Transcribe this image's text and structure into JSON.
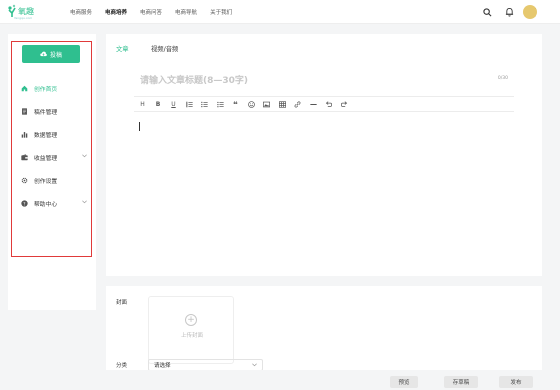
{
  "topbar": {
    "logo_text": "氧趣",
    "logo_sub": "Yangqu.com",
    "nav": [
      {
        "label": "电商服务",
        "active": false
      },
      {
        "label": "电商培养",
        "active": true
      },
      {
        "label": "电商问答",
        "active": false
      },
      {
        "label": "电商导航",
        "active": false
      },
      {
        "label": "关于我们",
        "active": false
      }
    ],
    "icons": [
      "search-icon",
      "bell-icon",
      "qrcode-icon"
    ]
  },
  "sidebar": {
    "post_button": "投稿",
    "items": [
      {
        "label": "创作首页",
        "icon": "home-icon",
        "active": true
      },
      {
        "label": "稿件管理",
        "icon": "document-icon"
      },
      {
        "label": "数据管理",
        "icon": "bar-chart-icon"
      },
      {
        "label": "收益管理",
        "icon": "wallet-icon",
        "expandable": true
      },
      {
        "label": "创作设置",
        "icon": "gear-icon"
      },
      {
        "label": "帮助中心",
        "icon": "help-icon",
        "expandable": true
      }
    ]
  },
  "editor": {
    "tabs": [
      {
        "label": "文章",
        "active": true
      },
      {
        "label": "视频/音频",
        "active": false
      }
    ],
    "title_placeholder": "请输入文章标题(8—30字)",
    "title_count": "0/30",
    "toolbar": [
      "H",
      "B",
      "U",
      "quote-block",
      "list",
      "ordered-list",
      "quote",
      "emoji",
      "image",
      "table",
      "link",
      "divider",
      "undo",
      "redo"
    ]
  },
  "cover": {
    "label": "封面",
    "upload_text": "上传封面"
  },
  "category": {
    "label": "分类",
    "placeholder": "请选择"
  },
  "actions": {
    "preview": "预览",
    "draft": "存草稿",
    "publish": "发布"
  },
  "colors": {
    "accent": "#2fbf8f",
    "highlight_border": "#e03a3a",
    "avatar": "#e6c86e"
  }
}
